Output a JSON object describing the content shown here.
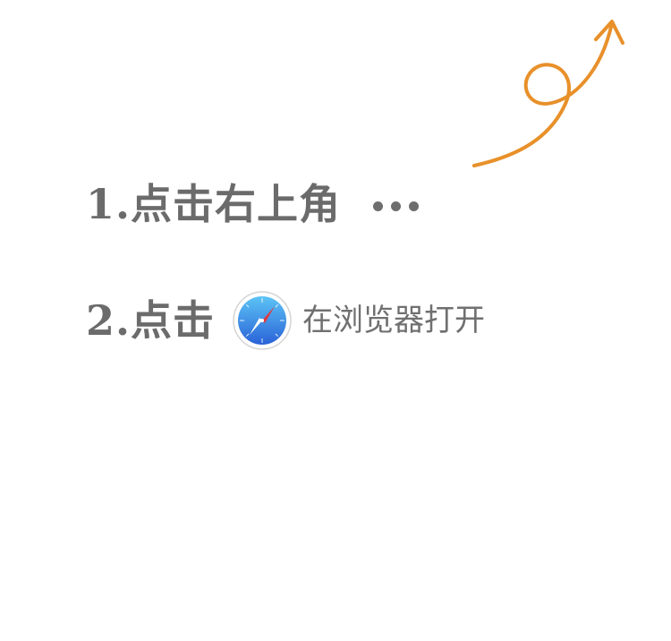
{
  "steps": {
    "step1": {
      "label": "1.点击右上角",
      "icon": "more-dots-icon"
    },
    "step2": {
      "label": "2.点击",
      "icon": "safari-compass-icon",
      "open_text": "在浏览器打开"
    }
  },
  "arrow": {
    "icon": "curly-arrow-up-right-icon",
    "color": "#E8902A"
  },
  "colors": {
    "text": "#6B6B6B",
    "safari_blue": "#3A86E8",
    "needle_red": "#E0393E"
  }
}
